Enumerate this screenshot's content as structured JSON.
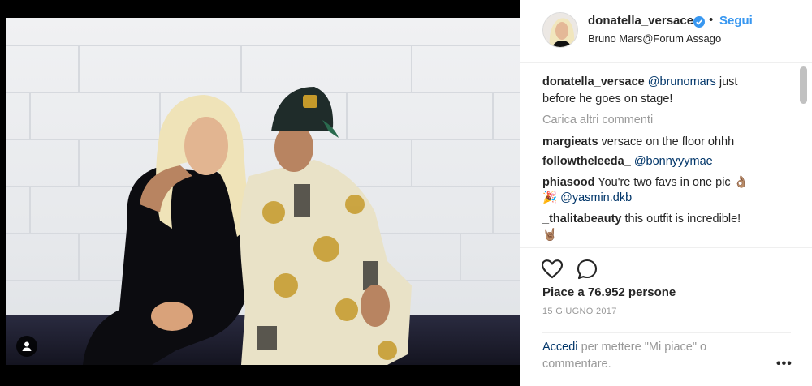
{
  "header": {
    "username": "donatella_versace",
    "separator": "•",
    "follow_label": "Segui",
    "location": "Bruno Mars@Forum Assago"
  },
  "caption": {
    "username": "donatella_versace",
    "mention": "@brunomars",
    "text_1": "just",
    "text_2": "before he goes on stage!"
  },
  "load_more": "Carica altri commenti",
  "comments": [
    {
      "username": "margieats",
      "text": "versace on the floor ohhh"
    },
    {
      "username": "followtheleeda_",
      "mention": "@bonnyyymae"
    },
    {
      "username": "phiasood",
      "text": "You're two favs in one pic",
      "emoji_1": "👌🏽",
      "emoji_2": "🎉",
      "mention": "@yasmin.dkb"
    },
    {
      "username": "_thalitabeauty",
      "text": "this outfit is incredible!",
      "emoji": "🤘🏽"
    }
  ],
  "likes_text": "Piace a 76.952 persone",
  "date": "15 GIUGNO 2017",
  "login": {
    "link": "Accedi",
    "text": "per mettere \"Mi piace\" o commentare."
  },
  "more_options": "•••",
  "icons": {
    "verified": "verified-badge-icon",
    "like": "heart-icon",
    "comment": "comment-bubble-icon",
    "user_tags": "user-tag-icon"
  },
  "colors": {
    "link_blue": "#3897f0",
    "mention_blue": "#003569",
    "muted_gray": "#999999"
  }
}
